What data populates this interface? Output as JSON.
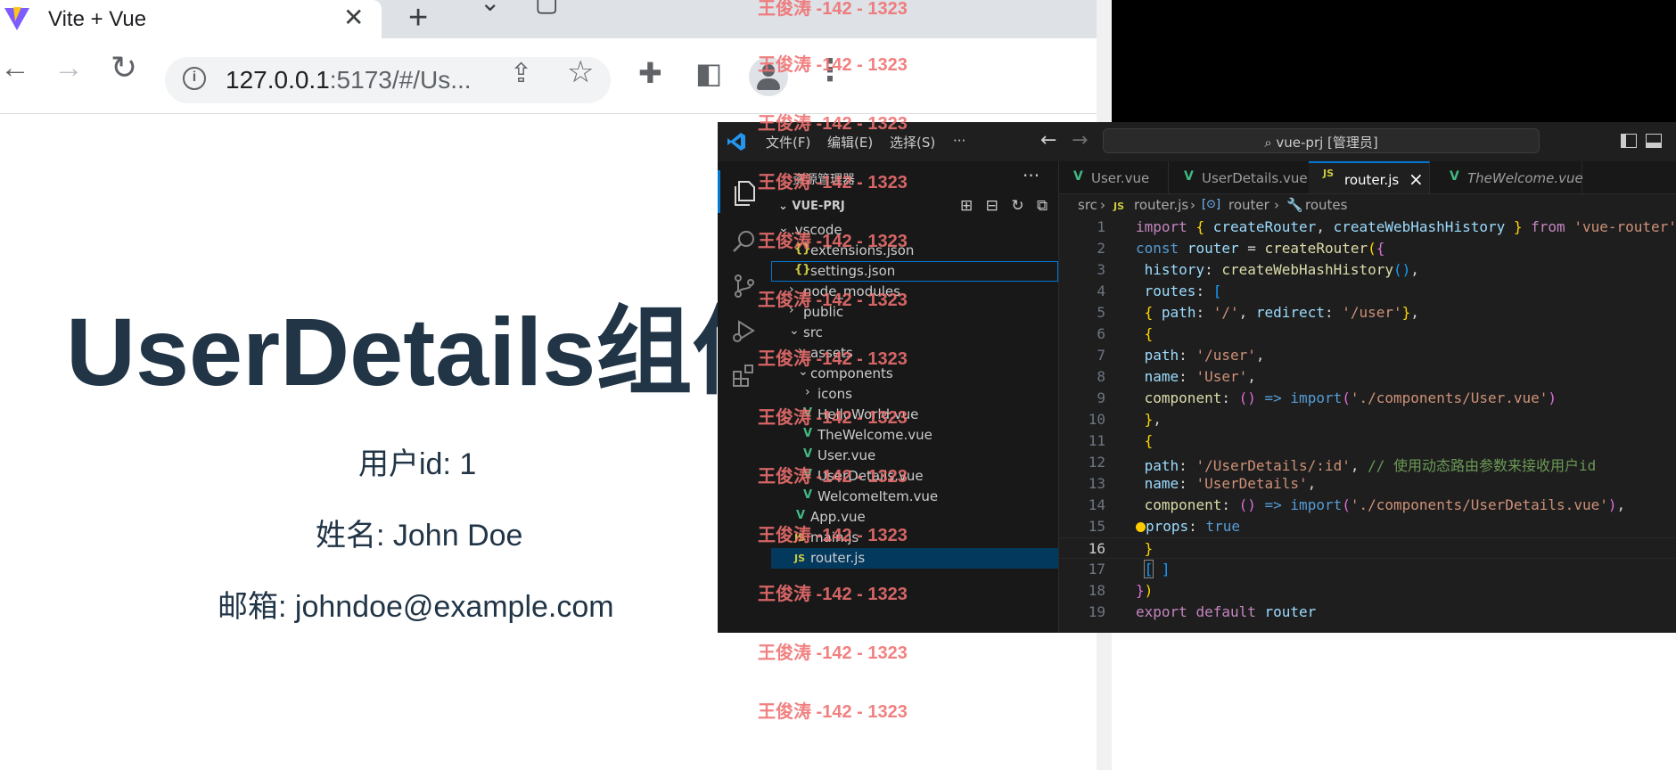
{
  "browser": {
    "tab_title": "Vite + Vue",
    "tab_close": "✕",
    "new_tab": "+",
    "url_host": "127.0.0.1",
    "url_rest": ":5173/#/Us...",
    "info": "i",
    "back": "←",
    "forward": "→",
    "reload": "↻",
    "share": "⇪",
    "star": "☆",
    "extensions": "✚",
    "sidepanel": "◧",
    "menu": "⋮"
  },
  "page": {
    "heading": "UserDetails组件",
    "details": [
      "用户id: 1",
      "姓名: John Doe",
      "邮箱: johndoe@example.com"
    ]
  },
  "vscode": {
    "menu": [
      "文件(F)",
      "编辑(E)",
      "选择(S)",
      "···"
    ],
    "search": "vue-prj [管理员]",
    "explorer_title": "资源管理器",
    "explorer_more": "···",
    "project": "VUE-PRJ",
    "project_actions": [
      "⊞",
      "⊟",
      "↻",
      "⧉"
    ],
    "tree": [
      {
        "label": ".vscode",
        "type": "folder-open"
      },
      {
        "label": "extensions.json",
        "type": "json"
      },
      {
        "label": "settings.json",
        "type": "json"
      },
      {
        "label": "node_modules",
        "type": "folder"
      },
      {
        "label": "public",
        "type": "folder"
      },
      {
        "label": "src",
        "type": "folder-open"
      },
      {
        "label": "assets",
        "type": "folder"
      },
      {
        "label": "components",
        "type": "folder-open"
      },
      {
        "label": "icons",
        "type": "folder"
      },
      {
        "label": "HelloWorld.vue",
        "type": "vue"
      },
      {
        "label": "TheWelcome.vue",
        "type": "vue"
      },
      {
        "label": "User.vue",
        "type": "vue"
      },
      {
        "label": "UserDetails.vue",
        "type": "vue"
      },
      {
        "label": "WelcomeItem.vue",
        "type": "vue"
      },
      {
        "label": "App.vue",
        "type": "vue"
      },
      {
        "label": "main.js",
        "type": "js"
      },
      {
        "label": "router.js",
        "type": "js"
      }
    ],
    "tabs": [
      "User.vue",
      "UserDetails.vue",
      "router.js",
      "TheWelcome.vue"
    ],
    "active_tab": "router.js",
    "breadcrumb": [
      "src",
      "router.js",
      "router",
      "routes"
    ],
    "line_numbers": [
      "1",
      "2",
      "3",
      "4",
      "5",
      "6",
      "7",
      "8",
      "9",
      "10",
      "11",
      "12",
      "13",
      "14",
      "15",
      "16",
      "17",
      "18",
      "19"
    ],
    "current_line": "16",
    "icons": {
      "vue": "V",
      "json": "{}",
      "js": "JS"
    }
  },
  "watermark": "王俊涛 -142 - 1323",
  "colors": {
    "heading": "#213547",
    "vscode_bg": "#1e1e1e",
    "accent": "#0078d4",
    "watermark": "#f07070"
  }
}
